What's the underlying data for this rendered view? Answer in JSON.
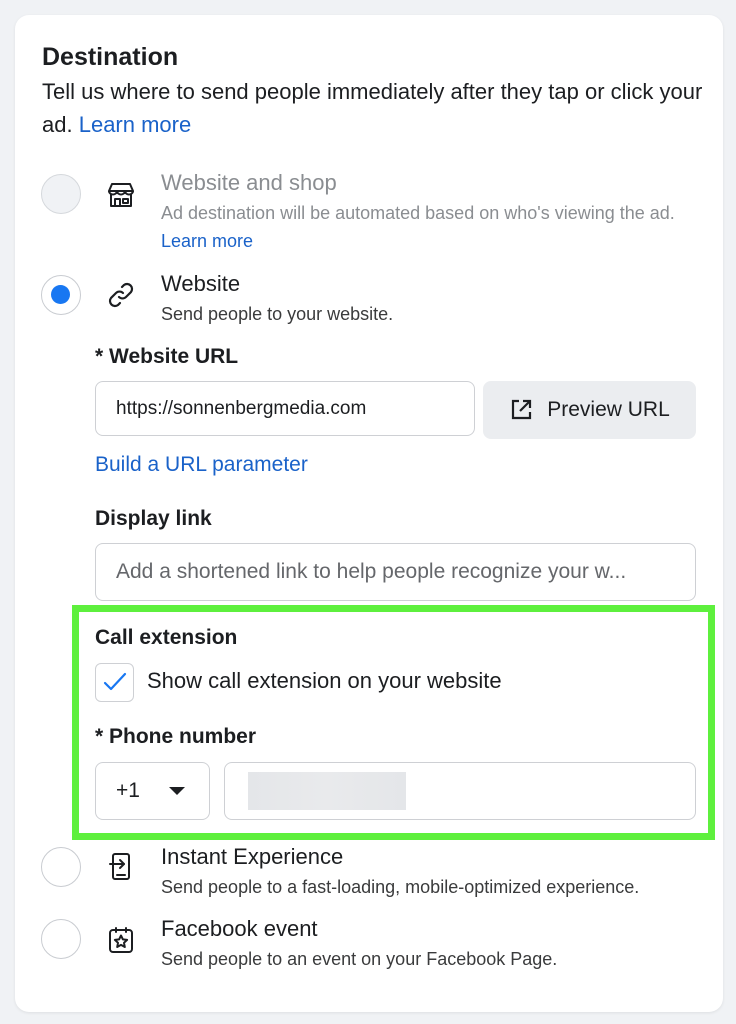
{
  "destination": {
    "title": "Destination",
    "description": "Tell us where to send people immediately after they tap or click your ad.",
    "learn_more": "Learn more"
  },
  "options": [
    {
      "title": "Website and shop",
      "subtitle": "Ad destination will be automated based on who's viewing the ad.",
      "learn_more": "Learn more",
      "icon": "storefront-icon",
      "selected": false,
      "disabled": true
    },
    {
      "title": "Website",
      "subtitle": "Send people to your website.",
      "icon": "link-icon",
      "selected": true,
      "disabled": false
    },
    {
      "title": "Instant Experience",
      "subtitle": "Send people to a fast-loading, mobile-optimized experience.",
      "icon": "mobile-icon",
      "selected": false,
      "disabled": false
    },
    {
      "title": "Facebook event",
      "subtitle": "Send people to an event on your Facebook Page.",
      "icon": "event-star-icon",
      "selected": false,
      "disabled": false
    }
  ],
  "website_url": {
    "label": "* Website URL",
    "value": "https://sonnenbergmedia.com",
    "preview_button": "Preview URL",
    "build_param_link": "Build a URL parameter"
  },
  "display_link": {
    "label": "Display link",
    "placeholder": "Add a shortened link to help people recognize your w..."
  },
  "call_extension": {
    "label": "Call extension",
    "checkbox_label": "Show call extension on your website",
    "checked": true,
    "phone_label": "* Phone number",
    "country_code": "+1"
  },
  "colors": {
    "accent": "#1877f2",
    "link": "#1a62c9",
    "highlight": "#5ef03d"
  }
}
